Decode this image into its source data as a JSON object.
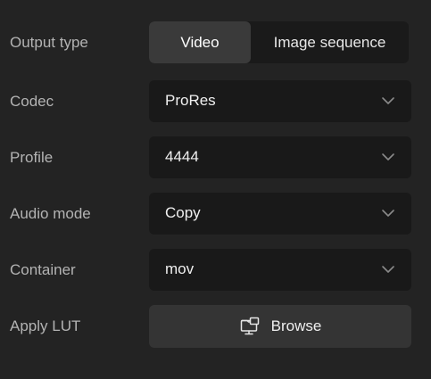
{
  "settings": {
    "output_type": {
      "label": "Output type",
      "options": [
        "Video",
        "Image sequence"
      ],
      "selected": "Video"
    },
    "codec": {
      "label": "Codec",
      "value": "ProRes",
      "icon": "chevron-down-icon"
    },
    "profile": {
      "label": "Profile",
      "value": "4444",
      "icon": "chevron-down-icon"
    },
    "audio_mode": {
      "label": "Audio mode",
      "value": "Copy",
      "icon": "chevron-down-icon"
    },
    "container": {
      "label": "Container",
      "value": "mov",
      "icon": "chevron-down-icon"
    },
    "apply_lut": {
      "label": "Apply LUT",
      "button_label": "Browse",
      "icon": "folder-monitor-icon"
    }
  },
  "colors": {
    "background": "#232323",
    "field_background": "#191919",
    "active_segment": "#3a3a3a",
    "button_background": "#343434",
    "label_text": "#b3b3b3",
    "value_text": "#f0f0f0"
  }
}
